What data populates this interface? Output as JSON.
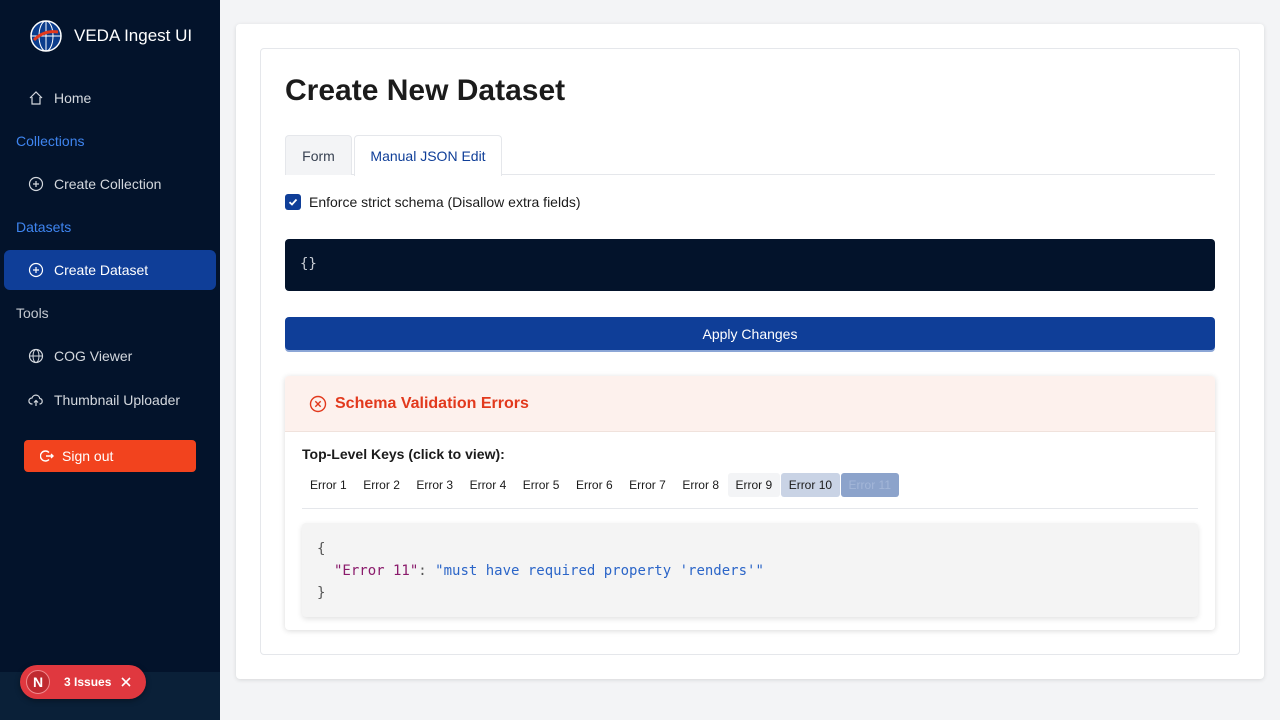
{
  "app": {
    "title": "VEDA Ingest UI"
  },
  "sidebar": {
    "home": "Home",
    "collections_section": "Collections",
    "create_collection": "Create Collection",
    "datasets_section": "Datasets",
    "create_dataset": "Create Dataset",
    "tools_section": "Tools",
    "cog_viewer": "COG Viewer",
    "thumbnail_uploader": "Thumbnail Uploader",
    "sign_out": "Sign out"
  },
  "issues_badge": {
    "letter": "N",
    "label": "3 Issues"
  },
  "main": {
    "title": "Create New Dataset",
    "tabs": [
      {
        "label": "Form",
        "active": false
      },
      {
        "label": "Manual JSON Edit",
        "active": true
      }
    ],
    "strict_schema": {
      "label": "Enforce strict schema (Disallow extra fields)",
      "checked": true
    },
    "editor_content": "{}",
    "apply_button": "Apply Changes",
    "errors": {
      "title": "Schema Validation Errors",
      "keys_label": "Top-Level Keys (click to view):",
      "keys": [
        "Error 1",
        "Error 2",
        "Error 3",
        "Error 4",
        "Error 5",
        "Error 6",
        "Error 7",
        "Error 8",
        "Error 9",
        "Error 10",
        "Error 11"
      ],
      "selected_key": "Error 11",
      "json_open": "{",
      "json_key": "\"Error 11\"",
      "json_sep": ": ",
      "json_value": "\"must have required property 'renders'\"",
      "json_close": "}"
    }
  },
  "colors": {
    "sidebar_bg": "#03132b",
    "accent": "#0f3e98",
    "signout": "#f2431e",
    "error": "#e2391d"
  }
}
